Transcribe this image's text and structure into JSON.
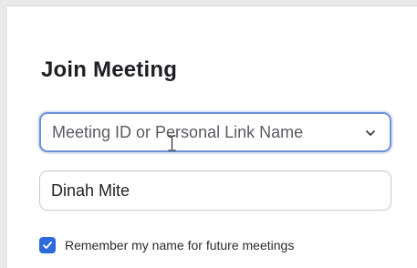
{
  "join_meeting": {
    "title": "Join Meeting",
    "meeting_input": {
      "placeholder": "Meeting ID or Personal Link Name",
      "value": ""
    },
    "name_input": {
      "value": "Dinah Mite"
    },
    "remember_checkbox": {
      "checked": true,
      "label": "Remember my name for future meetings"
    }
  },
  "icons": {
    "dropdown": "chevron-down-icon",
    "text_cursor": "ibeam-cursor-icon",
    "checked": "checkmark-icon"
  },
  "colors": {
    "focus_border": "#6b8fd6",
    "checkbox_fill": "#2d6bdb",
    "title_text": "#1f1f24"
  }
}
